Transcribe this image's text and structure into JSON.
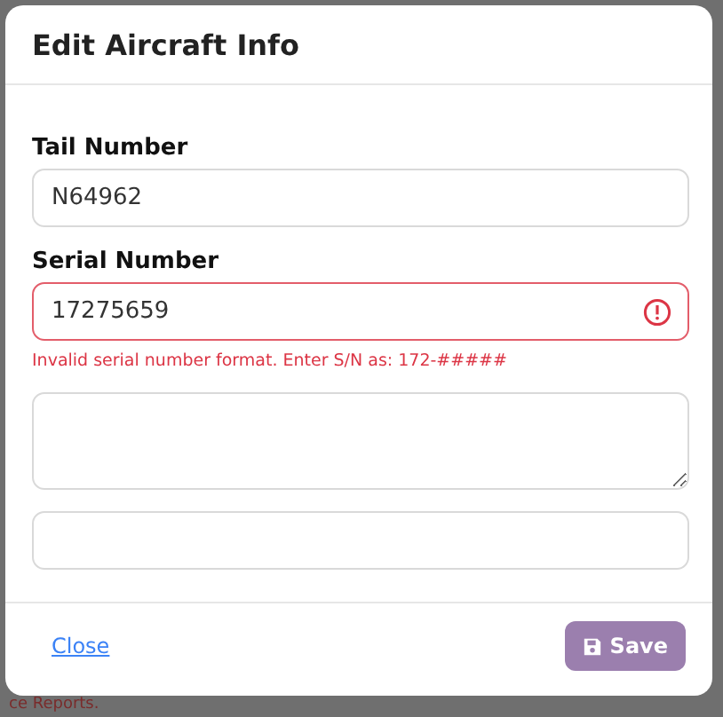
{
  "modal": {
    "title": "Edit Aircraft Info"
  },
  "fields": [
    {
      "kind": "input",
      "label": "Tail Number",
      "value": "N64962",
      "invalid": false
    },
    {
      "kind": "input",
      "label": "Serial Number",
      "value": "17275659",
      "invalid": true,
      "error": "Invalid serial number format. Enter S/N as: 172-#####"
    },
    {
      "kind": "textarea",
      "invalid": false
    },
    {
      "kind": "input",
      "invalid": false
    }
  ],
  "footer": {
    "close_link": "Close",
    "save_button": "Save"
  },
  "background_text": "ce Reports."
}
